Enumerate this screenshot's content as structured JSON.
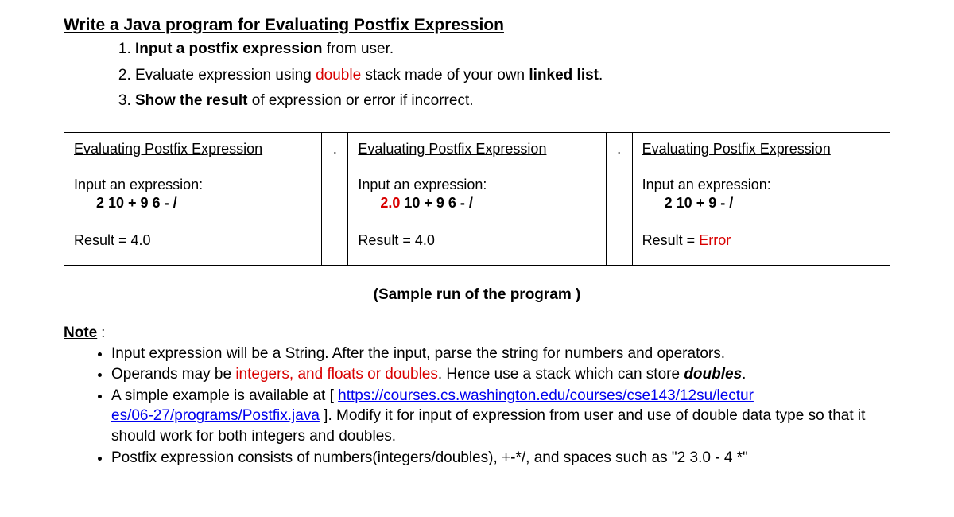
{
  "title": "Write a Java program for Evaluating Postfix Expression",
  "steps": {
    "s1_a": "Input a postfix expression",
    "s1_b": " from user.",
    "s2_a": "Evaluate expression using ",
    "s2_b": "double",
    "s2_c": " stack made of your own ",
    "s2_d": "linked list",
    "s2_e": ".",
    "s3_a": "Show the result",
    "s3_b": " of expression or error if incorrect."
  },
  "samples": [
    {
      "title": "Evaluating Postfix Expression",
      "prompt": "Input an expression:",
      "input_a": "2  10  +  9   6  -  /",
      "input_red": "",
      "input_b": "",
      "result_a": "Result =  4.0",
      "result_red": ""
    },
    {
      "title": "Evaluating Postfix Expression",
      "prompt": "Input an expression:",
      "input_a": "",
      "input_red": "2.0",
      "input_b": "  10  +  9   6  -  /",
      "result_a": "Result =  4.0",
      "result_red": ""
    },
    {
      "title": "Evaluating Postfix Expression",
      "prompt": "Input an expression:",
      "input_a": "2  10  +  9   -  /",
      "input_red": "",
      "input_b": "",
      "result_a": "Result =  ",
      "result_red": "Error"
    }
  ],
  "dot": ".",
  "caption": "(Sample run of the program )",
  "note_heading": "Note",
  "note_colon": " :",
  "notes": {
    "n1": "Input expression will be a String. After the input, parse the string for numbers and operators.",
    "n2_a": "Operands may be ",
    "n2_b": "integers, and floats or doubles",
    "n2_c": ". Hence use a stack which can store ",
    "n2_d": "doubles",
    "n2_e": ".",
    "n3_a": "A simple example is available at [ ",
    "n3_link1": "https://courses.cs.washington.edu/courses/cse143/12su/lectur",
    "n3_link2": "es/06-27/programs/Postfix.java",
    "n3_b": " ]. Modify it for input of expression from user and use of double data type so that it should work for both integers and doubles.",
    "n4": "Postfix expression consists of numbers(integers/doubles), +-*/, and spaces such as \"2 3.0 - 4 *\""
  }
}
